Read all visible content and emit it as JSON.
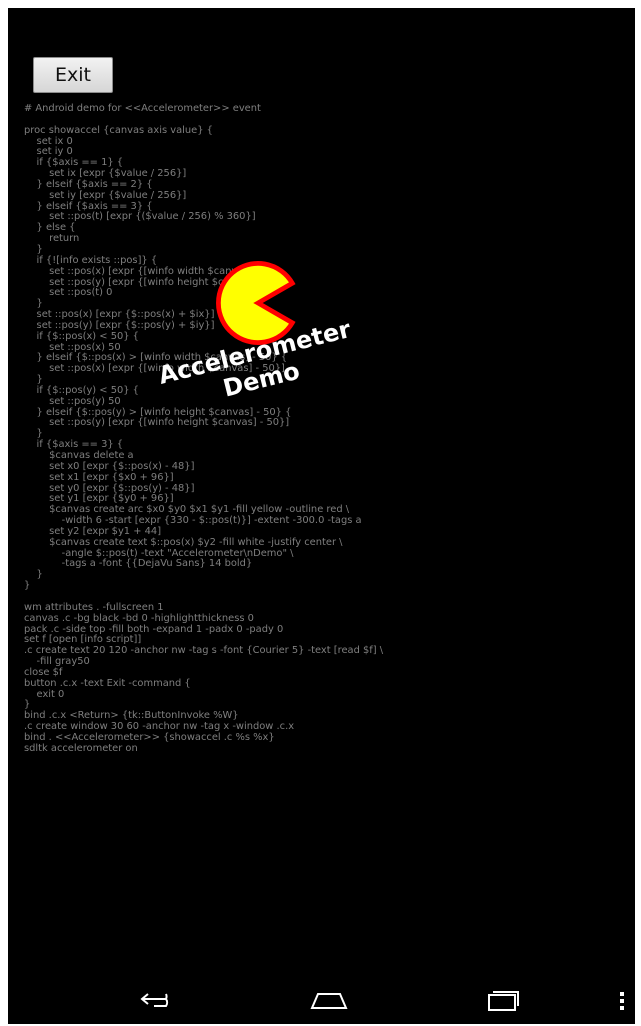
{
  "exit_button": {
    "label": "Exit"
  },
  "script_lines": [
    "# Android demo for <<Accelerometer>> event",
    "",
    "proc showaccel {canvas axis value} {",
    "    set ix 0",
    "    set iy 0",
    "    if {$axis == 1} {",
    "        set ix [expr {$value / 256}]",
    "    } elseif {$axis == 2} {",
    "        set iy [expr {$value / 256}]",
    "    } elseif {$axis == 3} {",
    "        set ::pos(t) [expr {($value / 256) % 360}]",
    "    } else {",
    "        return",
    "    }",
    "    if {![info exists ::pos]} {",
    "        set ::pos(x) [expr {[winfo width $canvas] / 4}]",
    "        set ::pos(y) [expr {[winfo height $canvas] / 4}]",
    "        set ::pos(t) 0",
    "    }",
    "    set ::pos(x) [expr {$::pos(x) + $ix}]",
    "    set ::pos(y) [expr {$::pos(y) + $iy}]",
    "    if {$::pos(x) < 50} {",
    "        set ::pos(x) 50",
    "    } elseif {$::pos(x) > [winfo width $canvas] - 50} {",
    "        set ::pos(x) [expr {[winfo width $canvas] - 50}]",
    "    }",
    "    if {$::pos(y) < 50} {",
    "        set ::pos(y) 50",
    "    } elseif {$::pos(y) > [winfo height $canvas] - 50} {",
    "        set ::pos(y) [expr {[winfo height $canvas] - 50}]",
    "    }",
    "    if {$axis == 3} {",
    "        $canvas delete a",
    "        set x0 [expr {$::pos(x) - 48}]",
    "        set x1 [expr {$x0 + 96}]",
    "        set y0 [expr {$::pos(y) - 48}]",
    "        set y1 [expr {$y0 + 96}]",
    "        $canvas create arc $x0 $y0 $x1 $y1 -fill yellow -outline red \\",
    "            -width 6 -start [expr {330 - $::pos(t)}] -extent -300.0 -tags a",
    "        set y2 [expr $y1 + 44]",
    "        $canvas create text $::pos(x) $y2 -fill white -justify center \\",
    "            -angle $::pos(t) -text \"Accelerometer\\nDemo\" \\",
    "            -tags a -font {{DejaVu Sans} 14 bold}",
    "    }",
    "}",
    "",
    "wm attributes . -fullscreen 1",
    "canvas .c -bg black -bd 0 -highlightthickness 0",
    "pack .c -side top -fill both -expand 1 -padx 0 -pady 0",
    "set f [open [info script]]",
    ".c create text 20 120 -anchor nw -tag s -font {Courier 5} -text [read $f] \\",
    "    -fill gray50",
    "close $f",
    "button .c.x -text Exit -command {",
    "    exit 0",
    "}",
    "bind .c.x <Return> {tk::ButtonInvoke %W}",
    ".c create window 30 60 -anchor nw -tag x -window .c.x",
    "bind . <<Accelerometer>> {showaccel .c %s %x}",
    "sdltk accelerometer on"
  ],
  "demo_label": {
    "line1": "Accelerometer",
    "line2": "Demo"
  },
  "pacman": {
    "fill": "#ffff00",
    "outline": "#ff0000"
  },
  "colors": {
    "background": "#000000",
    "script_text": "#7f7f7f",
    "label_text": "#ffffff",
    "nav_icons": "#ffffff"
  },
  "navbar": {
    "icons": [
      "back-icon",
      "home-icon",
      "recent-apps-icon",
      "overflow-menu-icon"
    ]
  }
}
